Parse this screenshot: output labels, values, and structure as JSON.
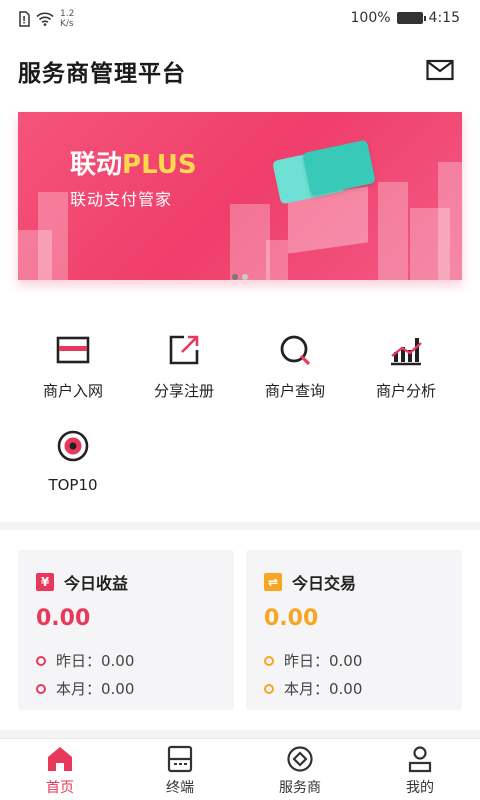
{
  "status_bar": {
    "speed_value": "1.2",
    "speed_unit": "K/s",
    "battery": "100%",
    "time": "4:15"
  },
  "header": {
    "title": "服务商管理平台",
    "mail_icon": "mail-icon"
  },
  "banner": {
    "title_main": "联动",
    "title_accent": "PLUS",
    "subtitle": "联动支付管家",
    "slides": 2,
    "active_slide": 1
  },
  "menu": {
    "items": [
      {
        "label": "商户入网",
        "icon": "card-icon"
      },
      {
        "label": "分享注册",
        "icon": "share-icon"
      },
      {
        "label": "商户查询",
        "icon": "query-icon"
      },
      {
        "label": "商户分析",
        "icon": "analysis-icon"
      },
      {
        "label": "TOP10",
        "icon": "target-icon"
      }
    ]
  },
  "stats": {
    "income": {
      "badge": "¥",
      "title": "今日收益",
      "value": "0.00",
      "yesterday": "昨日：0.00",
      "month": "本月：0.00",
      "color": "#e8385b"
    },
    "trade": {
      "badge": "⇌",
      "title": "今日交易",
      "value": "0.00",
      "yesterday": "昨日：0.00",
      "month": "本月：0.00",
      "color": "#f5a623"
    }
  },
  "tabbar": {
    "tabs": [
      {
        "label": "首页",
        "icon": "home-icon",
        "active": true
      },
      {
        "label": "终端",
        "icon": "terminal-icon",
        "active": false
      },
      {
        "label": "服务商",
        "icon": "provider-icon",
        "active": false
      },
      {
        "label": "我的",
        "icon": "profile-icon",
        "active": false
      }
    ]
  },
  "colors": {
    "accent": "#e8385b",
    "banner": "#f04a72",
    "trade": "#f5a623"
  }
}
